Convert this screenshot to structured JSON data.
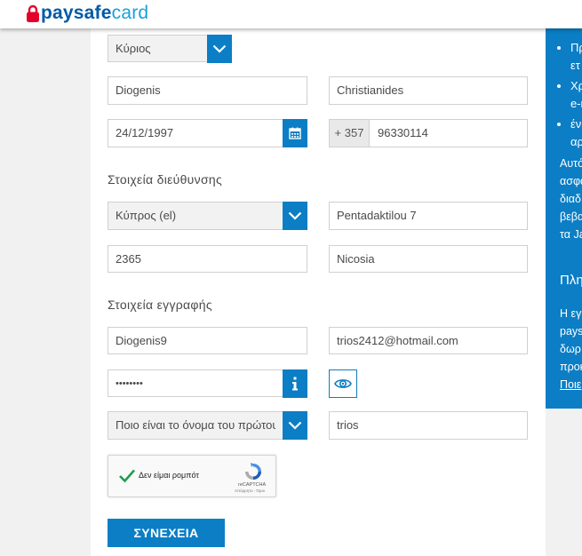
{
  "brand": {
    "part1": "paysafe",
    "part2": "card"
  },
  "form": {
    "title_select": {
      "value": "Κύριος"
    },
    "first_name": {
      "value": "Diogenis"
    },
    "last_name": {
      "value": "Christianides"
    },
    "birth_date": {
      "value": "24/12/1997"
    },
    "phone": {
      "prefix": "+ 357",
      "number": "96330114"
    },
    "address_section_title": "Στοιχεία διεύθυνσης",
    "country_select": {
      "value": "Κύπρος (el)"
    },
    "street": {
      "value": "Pentadaktilou 7"
    },
    "postal_code": {
      "value": "2365"
    },
    "city": {
      "value": "Nicosia"
    },
    "registration_section_title": "Στοιχεία εγγραφής",
    "username": {
      "value": "Diogenis9"
    },
    "email": {
      "value": "trios2412@hotmail.com"
    },
    "password": {
      "value": "••••••••"
    },
    "security_question_select": {
      "value": "Ποιο είναι το όνομα του πρώτου"
    },
    "security_answer": {
      "value": "trios"
    },
    "captcha": {
      "label": "Δεν είμαι ρομπότ",
      "brand": "reCAPTCHA",
      "terms": "Απόρρητο - Όροι"
    },
    "submit_label": "ΣΥΝΕΧΕΙΑ"
  },
  "side_panel": {
    "bullets": [
      {
        "line1": "Πρ",
        "line2": "ετ"
      },
      {
        "line1": "Χρ",
        "line2": "e-m"
      },
      {
        "line1": "έν",
        "line2": "αρ"
      }
    ],
    "paragraph": "Αυτό\nασφα\nδιαδ\nβεβα\nτα Ja",
    "heading": "Πληρ",
    "paragraph2": "Η εγ\npays\nδωρ\nπροκ",
    "link": "Ποιε"
  },
  "colors": {
    "accent": "#0b7ec5",
    "brand_dark": "#005aa6",
    "brand_light": "#19a0dc",
    "lock_red": "#e4002b"
  },
  "icons": {
    "chevron": "chevron-down-icon",
    "calendar": "calendar-icon",
    "info": "info-icon",
    "eye": "eye-icon",
    "check": "checkmark-icon",
    "recaptcha": "recaptcha-logo-icon",
    "lock": "lock-icon"
  }
}
